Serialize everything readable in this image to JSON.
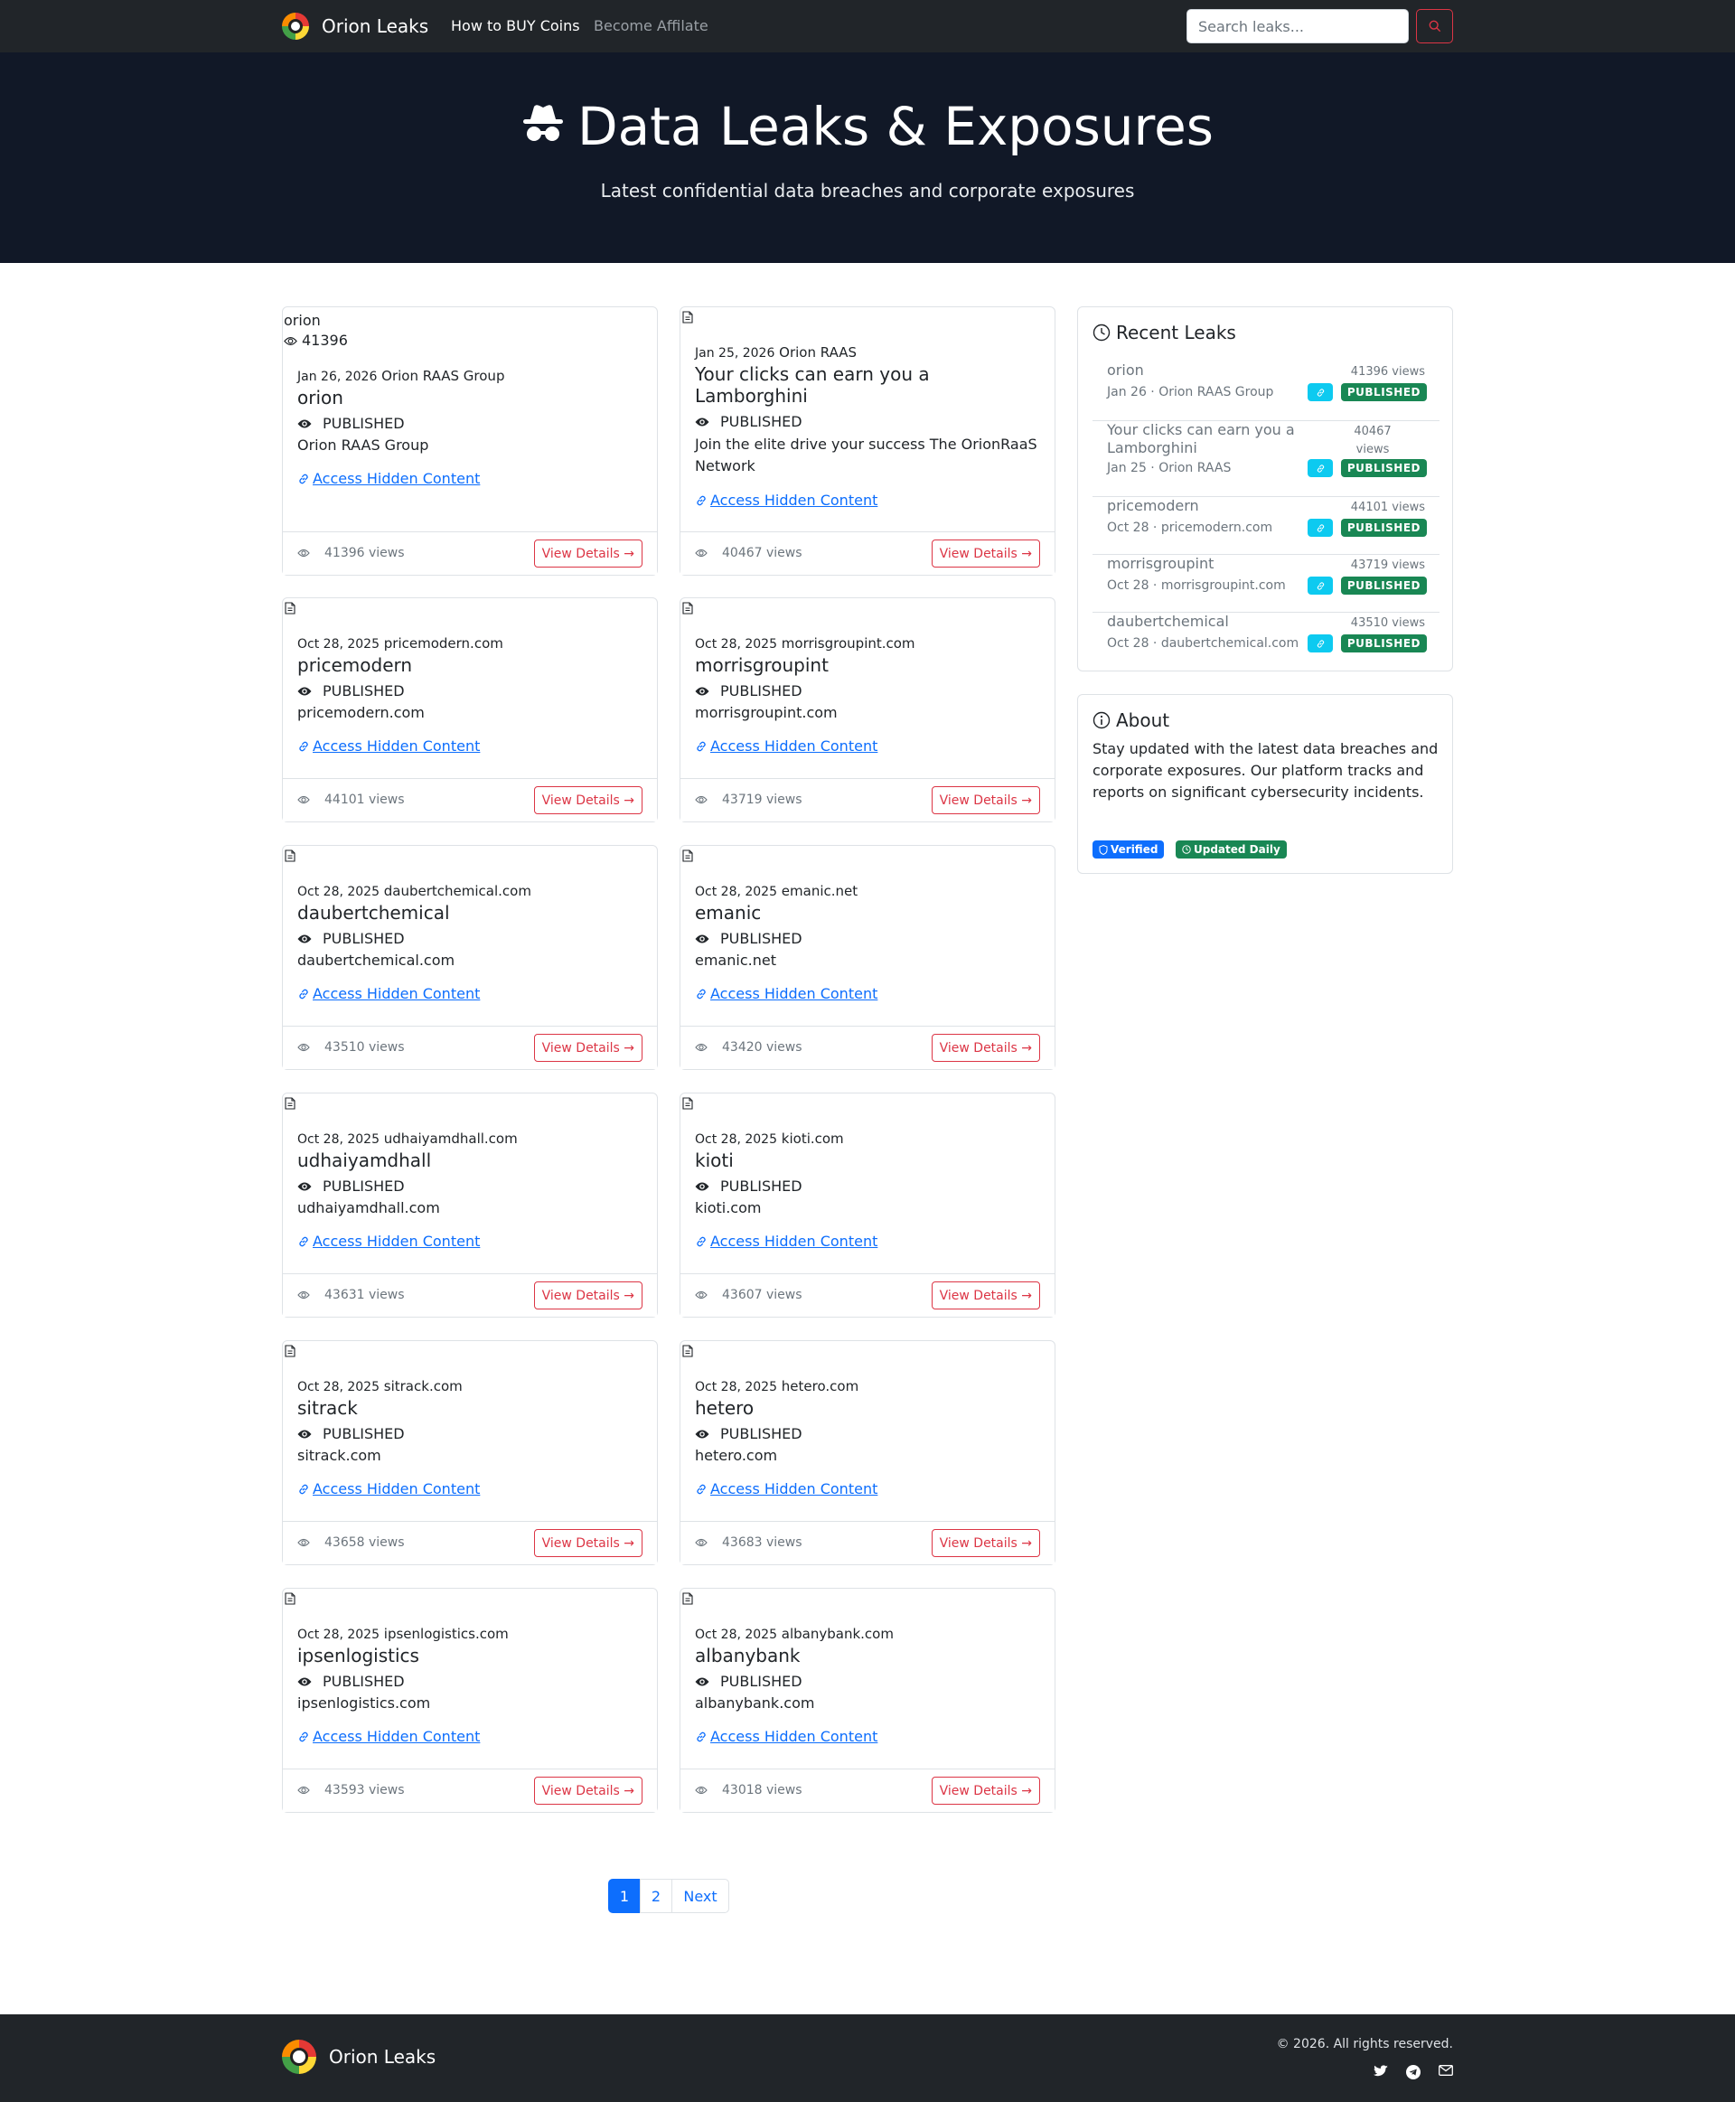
{
  "nav": {
    "brand": "Orion Leaks",
    "links": [
      "How to BUY Coins",
      "Become Affilate"
    ],
    "search_placeholder": "Search leaks..."
  },
  "hero": {
    "title": "Data Leaks & Exposures",
    "subtitle": "Latest confidential data breaches and corporate exposures"
  },
  "cards": [
    {
      "date": "Jan 26, 2026",
      "company": "Orion RAAS Group",
      "title": "orion",
      "status": "PUBLISHED",
      "desc": "Orion RAAS Group",
      "access": "Access Hidden Content",
      "views": "41396 views",
      "details": "View Details →",
      "top_name": "orion",
      "top_views": "41396"
    },
    {
      "date": "Jan 25, 2026",
      "company": "Orion RAAS",
      "title": "Your clicks can earn you a Lamborghini",
      "status": "PUBLISHED",
      "desc": "Join the elite drive your success The OrionRaaS Network",
      "access": "Access Hidden Content",
      "views": "40467 views",
      "details": "View Details →"
    },
    {
      "date": "Oct 28, 2025",
      "company": "pricemodern.com",
      "title": "pricemodern",
      "status": "PUBLISHED",
      "desc": "pricemodern.com",
      "access": "Access Hidden Content",
      "views": "44101 views",
      "details": "View Details →"
    },
    {
      "date": "Oct 28, 2025",
      "company": "morrisgroupint.com",
      "title": "morrisgroupint",
      "status": "PUBLISHED",
      "desc": "morrisgroupint.com",
      "access": "Access Hidden Content",
      "views": "43719 views",
      "details": "View Details →"
    },
    {
      "date": "Oct 28, 2025",
      "company": "daubertchemical.com",
      "title": "daubertchemical",
      "status": "PUBLISHED",
      "desc": "daubertchemical.com",
      "access": "Access Hidden Content",
      "views": "43510 views",
      "details": "View Details →"
    },
    {
      "date": "Oct 28, 2025",
      "company": "emanic.net",
      "title": "emanic",
      "status": "PUBLISHED",
      "desc": "emanic.net",
      "access": "Access Hidden Content",
      "views": "43420 views",
      "details": "View Details →"
    },
    {
      "date": "Oct 28, 2025",
      "company": "udhaiyamdhall.com",
      "title": "udhaiyamdhall",
      "status": "PUBLISHED",
      "desc": "udhaiyamdhall.com",
      "access": "Access Hidden Content",
      "views": "43631 views",
      "details": "View Details →"
    },
    {
      "date": "Oct 28, 2025",
      "company": "kioti.com",
      "title": "kioti",
      "status": "PUBLISHED",
      "desc": "kioti.com",
      "access": "Access Hidden Content",
      "views": "43607 views",
      "details": "View Details →"
    },
    {
      "date": "Oct 28, 2025",
      "company": "sitrack.com",
      "title": "sitrack",
      "status": "PUBLISHED",
      "desc": "sitrack.com",
      "access": "Access Hidden Content",
      "views": "43658 views",
      "details": "View Details →"
    },
    {
      "date": "Oct 28, 2025",
      "company": "hetero.com",
      "title": "hetero",
      "status": "PUBLISHED",
      "desc": "hetero.com",
      "access": "Access Hidden Content",
      "views": "43683 views",
      "details": "View Details →"
    },
    {
      "date": "Oct 28, 2025",
      "company": "ipsenlogistics.com",
      "title": "ipsenlogistics",
      "status": "PUBLISHED",
      "desc": "ipsenlogistics.com",
      "access": "Access Hidden Content",
      "views": "43593 views",
      "details": "View Details →"
    },
    {
      "date": "Oct 28, 2025",
      "company": "albanybank.com",
      "title": "albanybank",
      "status": "PUBLISHED",
      "desc": "albanybank.com",
      "access": "Access Hidden Content",
      "views": "43018 views",
      "details": "View Details →"
    }
  ],
  "recent": {
    "heading": "Recent Leaks",
    "items": [
      {
        "title": "orion",
        "views": "41396 views",
        "meta": "Jan 26 · Orion RAAS Group",
        "badge": "PUBLISHED"
      },
      {
        "title": "Your clicks can earn you a Lamborghini",
        "views": "40467 views",
        "meta": "Jan 25 · Orion RAAS",
        "badge": "PUBLISHED"
      },
      {
        "title": "pricemodern",
        "views": "44101 views",
        "meta": "Oct 28 · pricemodern.com",
        "badge": "PUBLISHED"
      },
      {
        "title": "morrisgroupint",
        "views": "43719 views",
        "meta": "Oct 28 · morrisgroupint.com",
        "badge": "PUBLISHED"
      },
      {
        "title": "daubertchemical",
        "views": "43510 views",
        "meta": "Oct 28 · daubertchemical.com",
        "badge": "PUBLISHED"
      }
    ]
  },
  "about": {
    "heading": "About",
    "text": "Stay updated with the latest data breaches and corporate exposures. Our platform tracks and reports on significant cybersecurity incidents.",
    "badges": [
      "Verified",
      "Updated Daily"
    ]
  },
  "pagination": {
    "pages": [
      "1",
      "2"
    ],
    "next": "Next"
  },
  "footer": {
    "brand": "Orion Leaks",
    "copyright": "© 2026. All rights reserved."
  }
}
